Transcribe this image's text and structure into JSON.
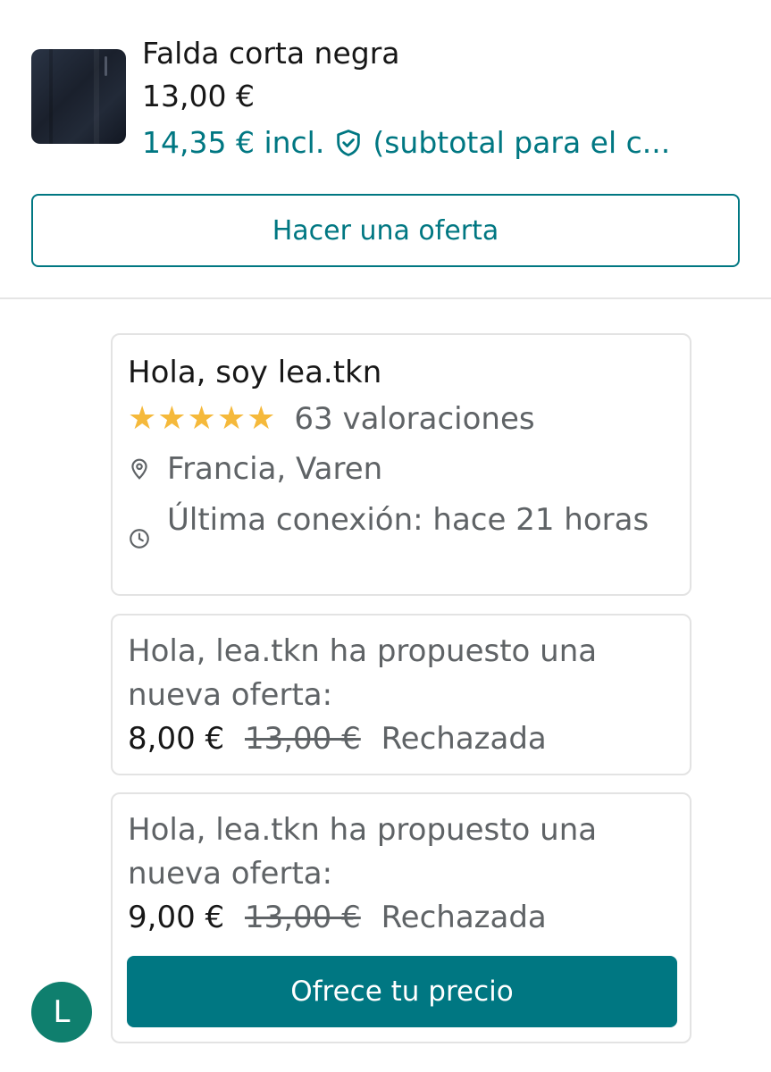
{
  "product": {
    "title": "Falda corta negra",
    "price": "13,00 €",
    "total_price": "14,35 € incl.",
    "total_note": "(subtotal para el c...",
    "thumbnail_icon": "product-photo"
  },
  "offer_button": {
    "label": "Hacer una oferta"
  },
  "seller_card": {
    "greeting": "Hola, soy lea.tkn",
    "stars": "★★★★★",
    "rating_value": 5,
    "rating_count": "63 valoraciones",
    "location": "Francia, Varen",
    "last_seen": "Última conexión: hace 21 horas"
  },
  "offers": [
    {
      "message": "Hola, lea.tkn ha propuesto una nueva oferta:",
      "amount": "8,00 €",
      "original": "13,00 €",
      "status": "Rechazada"
    },
    {
      "message": "Hola, lea.tkn ha propuesto una nueva oferta:",
      "amount": "9,00 €",
      "original": "13,00 €",
      "status": "Rechazada",
      "button": "Ofrece tu precio"
    }
  ],
  "avatar": {
    "initial": "L"
  },
  "colors": {
    "accent": "#007782",
    "star": "#f5b93b",
    "avatar_bg": "#0f7f6e",
    "muted_text": "#5f6366",
    "border": "#e3e3e3"
  },
  "icons": {
    "shield": "shield-check-icon",
    "location": "location-pin-icon",
    "clock": "clock-icon"
  }
}
